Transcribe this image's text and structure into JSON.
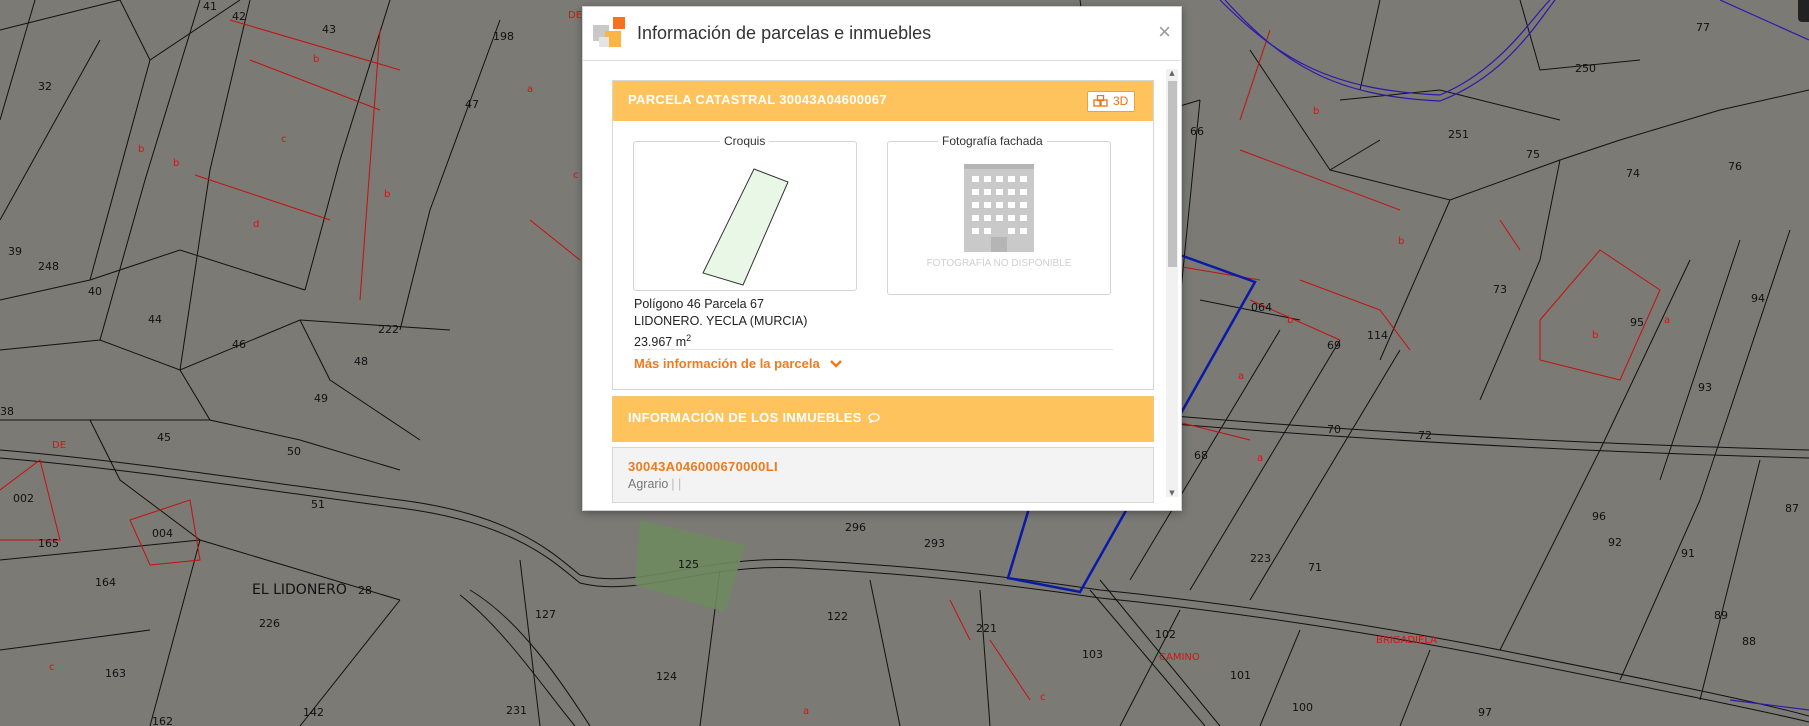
{
  "map": {
    "parcel_numbers": [
      "41",
      "42",
      "43",
      "198",
      "32",
      "47",
      "250",
      "77",
      "66",
      "251",
      "75",
      "74",
      "76",
      "39",
      "248",
      "40",
      "44",
      "46",
      "222",
      "48",
      "49",
      "45",
      "50",
      "51",
      "38",
      "002",
      "165",
      "004",
      "164",
      "226",
      "163",
      "162",
      "142",
      "231",
      "124",
      "127",
      "122",
      "125",
      "296",
      "293",
      "221",
      "102",
      "103",
      "101",
      "100",
      "97",
      "73",
      "064",
      "69",
      "114",
      "95",
      "94",
      "93",
      "68",
      "70",
      "72",
      "96",
      "92",
      "91",
      "89",
      "88",
      "87",
      "223",
      "71"
    ],
    "place_name": "EL LIDONERO",
    "place_number": "28",
    "road_labels": [
      "DE",
      "DE",
      "CAMINO",
      "BRIGADIELA"
    ],
    "subparcel_letters": [
      "a",
      "b",
      "c",
      "d"
    ]
  },
  "modal": {
    "title": "Información de parcelas e inmuebles",
    "close": "×",
    "parcela": {
      "header": "PARCELA CATASTRAL 30043A04600067",
      "btn_3d": "3D",
      "croquis_label": "Croquis",
      "foto_label": "Fotografía fachada",
      "foto_placeholder": "FOTOGRAFÍA NO DISPONIBLE",
      "line1": "Polígono 46 Parcela 67",
      "line2": "LIDONERO. YECLA (MURCIA)",
      "area": "23.967 m",
      "area_unit_sup": "2",
      "more_link": "Más información de la parcela"
    },
    "inmuebles": {
      "header": "INFORMACIÓN DE LOS INMUEBLES",
      "ref": "30043A046000670000LI",
      "use": "Agrario",
      "sep": "| |"
    }
  },
  "colors": {
    "accent_orange": "#f07a1c",
    "header_yellow": "#fec35c",
    "map_background": "#7b7a75",
    "selected_outline": "#0a1aa8",
    "subparcel_red": "#d11111"
  }
}
